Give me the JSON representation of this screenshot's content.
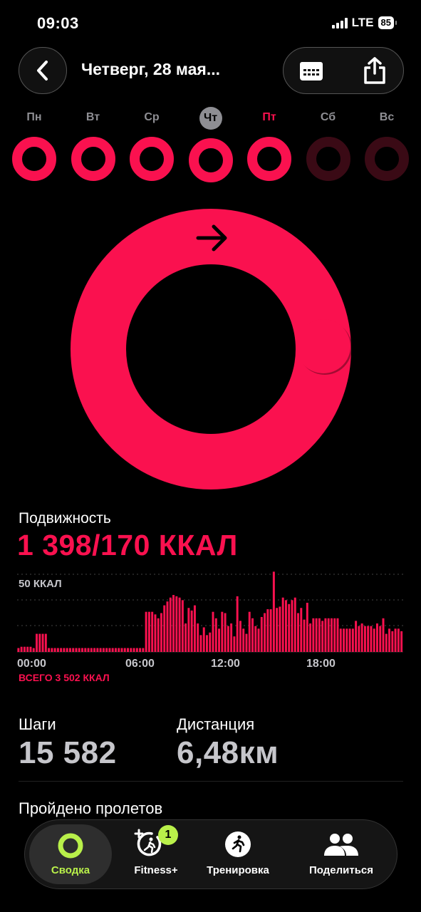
{
  "status": {
    "time": "09:03",
    "network": "LTE",
    "battery": "85"
  },
  "header": {
    "title": "Четверг, 28 мая...",
    "back_icon": "chevron-left-icon",
    "calendar_icon": "calendar-icon",
    "share_icon": "share-icon"
  },
  "week": [
    {
      "label": "Пн",
      "state": "past",
      "progress": 1.0
    },
    {
      "label": "Вт",
      "state": "past",
      "progress": 1.0
    },
    {
      "label": "Ср",
      "state": "past",
      "progress": 1.0
    },
    {
      "label": "Чт",
      "state": "selected",
      "progress": 1.0
    },
    {
      "label": "Пт",
      "state": "current",
      "progress": 1.0
    },
    {
      "label": "Сб",
      "state": "future",
      "progress": 0
    },
    {
      "label": "Вс",
      "state": "future",
      "progress": 0
    }
  ],
  "colors": {
    "move": "#fa114f",
    "move_dim": "#3a0a15",
    "accent": "#b9f04a"
  },
  "move": {
    "label": "Подвижность",
    "value": "1 398/170 ККАЛ",
    "progress": 8.22
  },
  "chart_data": {
    "type": "bar",
    "ymax_label": "50 ККАЛ",
    "x_ticks": [
      "00:00",
      "06:00",
      "12:00",
      "18:00"
    ],
    "total": "ВСЕГО 3 502 ККАЛ",
    "ylim": [
      0,
      60
    ],
    "values": [
      3,
      4,
      4,
      4,
      4,
      3,
      14,
      14,
      14,
      14,
      3,
      3,
      3,
      3,
      3,
      3,
      3,
      3,
      3,
      3,
      3,
      3,
      3,
      3,
      3,
      3,
      3,
      3,
      3,
      3,
      3,
      3,
      3,
      3,
      3,
      3,
      3,
      3,
      3,
      3,
      3,
      3,
      31,
      31,
      31,
      29,
      26,
      30,
      36,
      39,
      42,
      44,
      43,
      42,
      40,
      22,
      34,
      32,
      36,
      22,
      13,
      19,
      13,
      15,
      31,
      26,
      18,
      31,
      30,
      20,
      22,
      12,
      43,
      24,
      18,
      14,
      31,
      26,
      20,
      18,
      27,
      30,
      33,
      33,
      62,
      34,
      35,
      42,
      40,
      37,
      40,
      42,
      30,
      34,
      25,
      38,
      22,
      26,
      26,
      26,
      24,
      26,
      26,
      26,
      26,
      26,
      18,
      18,
      18,
      18,
      18,
      24,
      20,
      22,
      20,
      20,
      20,
      18,
      22,
      20,
      26,
      14,
      18,
      16,
      18,
      18,
      16
    ]
  },
  "steps": {
    "label": "Шаги",
    "value": "15 582"
  },
  "distance": {
    "label": "Дистанция",
    "value": "6,48км"
  },
  "flights": {
    "label": "Пройдено пролетов"
  },
  "tabs": [
    {
      "label": "Сводка",
      "icon": "activity-rings-icon",
      "active": true
    },
    {
      "label": "Fitness+",
      "icon": "fitness-plus-icon",
      "badge": "1"
    },
    {
      "label": "Тренировка",
      "icon": "running-figure-icon"
    },
    {
      "label": "Поделиться",
      "icon": "people-icon"
    }
  ]
}
